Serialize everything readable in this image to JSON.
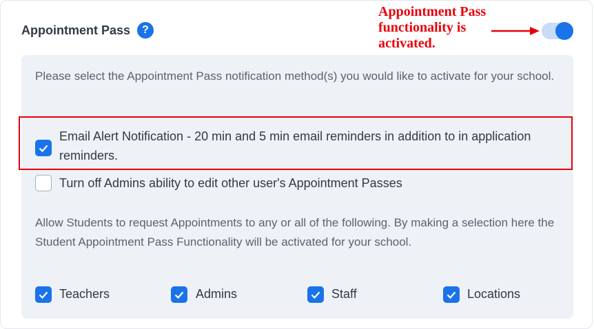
{
  "section": {
    "title": "Appointment Pass",
    "help_icon": "question-circle-icon",
    "toggle_on": true
  },
  "annotation": {
    "line1": "Appointment Pass",
    "line2": "functionality is",
    "line3": "activated.",
    "color": "#e8000b"
  },
  "notification": {
    "description": "Please select the Appointment Pass notification method(s) you would like to activate for your school.",
    "email_alert": {
      "checked": true,
      "label": "Email Alert Notification - 20 min and 5 min email reminders in addition to in application reminders."
    },
    "admins_edit": {
      "checked": false,
      "label": "Turn off Admins ability to edit other user's Appointment Passes"
    }
  },
  "student_requests": {
    "description": "Allow Students to request Appointments to any or all of the following. By making a selection here the Student Appointment Pass Functionality will be activated for your school.",
    "options": [
      {
        "label": "Teachers",
        "checked": true
      },
      {
        "label": "Admins",
        "checked": true
      },
      {
        "label": "Staff",
        "checked": true
      },
      {
        "label": "Locations",
        "checked": true
      }
    ]
  },
  "colors": {
    "accent": "#1a73e8",
    "panel_bg": "#eef1f5",
    "annotation_red": "#e8000b"
  }
}
